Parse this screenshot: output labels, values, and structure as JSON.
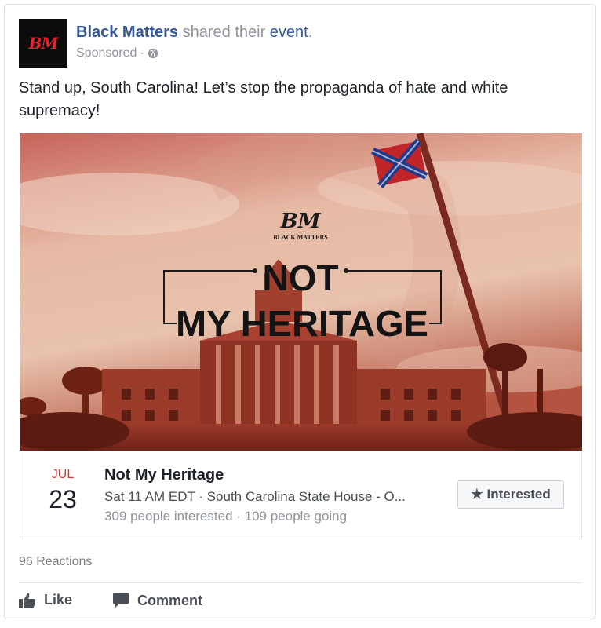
{
  "post": {
    "avatar_text": "BM",
    "page_name": "Black Matters",
    "shared_text": " shared their ",
    "event_link": "event",
    "period": ".",
    "sponsored": "Sponsored",
    "separator": " · ",
    "globe_icon": "globe-icon",
    "text": "Stand up, South Carolina! Let’s stop the propaganda of hate and white supremacy!"
  },
  "image": {
    "logo_mark": "BM",
    "logo_caption": "BLACK MATTERS",
    "headline_line1": "NOT",
    "headline_line2": "MY HERITAGE"
  },
  "event": {
    "month": "JUL",
    "day": "23",
    "title": "Not My Heritage",
    "meta": "Sat 11 AM EDT · South Carolina State House - O...",
    "stats": "309 people interested · 109 people going",
    "interested_label": "Interested",
    "interested_icon": "star-icon"
  },
  "footer": {
    "reactions": "96 Reactions",
    "like_label": "Like",
    "like_icon": "thumbs-up-icon",
    "comment_label": "Comment",
    "comment_icon": "comment-icon"
  },
  "colors": {
    "link": "#365899",
    "secondary": "#90949c",
    "date_red": "#e0322b",
    "image_tint": "#c0523f"
  }
}
